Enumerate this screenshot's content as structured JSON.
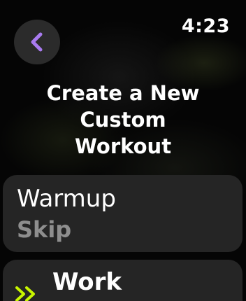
{
  "status_bar": {
    "time": "4:23"
  },
  "navigation": {
    "back_icon": "chevron-left-icon",
    "accent_color": "#a97bf0"
  },
  "header": {
    "title": "Create a New\nCustom\nWorkout"
  },
  "sections": {
    "warmup": {
      "label": "Warmup",
      "value": "Skip"
    },
    "work": {
      "label": "Work",
      "icon": "double-chevron-right-icon",
      "icon_color": "#c8f500"
    }
  }
}
